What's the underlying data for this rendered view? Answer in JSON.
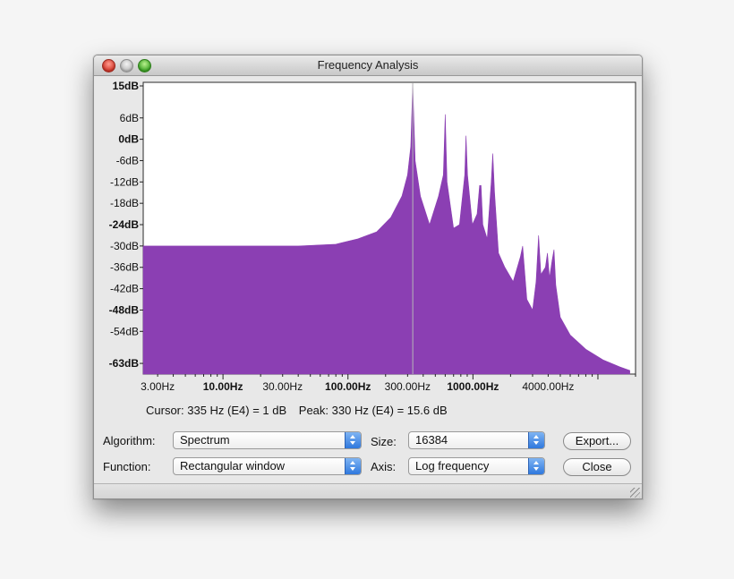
{
  "window": {
    "title": "Frequency Analysis"
  },
  "chart_data": {
    "type": "area",
    "title": "",
    "xlabel": "",
    "ylabel": "",
    "x_scale": "log",
    "xlim": [
      2.3,
      20000
    ],
    "ylim": [
      -66,
      16
    ],
    "grid": false,
    "fill_color": "#8b3fb3",
    "y_ticks": [
      {
        "v": 15,
        "label": "15dB",
        "major": true
      },
      {
        "v": 6,
        "label": "6dB",
        "major": false
      },
      {
        "v": 0,
        "label": "0dB",
        "major": true
      },
      {
        "v": -6,
        "label": "-6dB",
        "major": false
      },
      {
        "v": -12,
        "label": "-12dB",
        "major": false
      },
      {
        "v": -18,
        "label": "-18dB",
        "major": false
      },
      {
        "v": -24,
        "label": "-24dB",
        "major": true
      },
      {
        "v": -30,
        "label": "-30dB",
        "major": false
      },
      {
        "v": -36,
        "label": "-36dB",
        "major": false
      },
      {
        "v": -42,
        "label": "-42dB",
        "major": false
      },
      {
        "v": -48,
        "label": "-48dB",
        "major": true
      },
      {
        "v": -54,
        "label": "-54dB",
        "major": false
      },
      {
        "v": -63,
        "label": "-63dB",
        "major": true
      }
    ],
    "x_ticks": [
      {
        "v": 3,
        "label": "3.00Hz",
        "major": false
      },
      {
        "v": 10,
        "label": "10.00Hz",
        "major": true
      },
      {
        "v": 30,
        "label": "30.00Hz",
        "major": false
      },
      {
        "v": 100,
        "label": "100.00Hz",
        "major": true
      },
      {
        "v": 300,
        "label": "300.00Hz",
        "major": false
      },
      {
        "v": 1000,
        "label": "1000.00Hz",
        "major": true
      },
      {
        "v": 4000,
        "label": "4000.00Hz",
        "major": false
      }
    ],
    "spectrum": [
      {
        "x": 2.3,
        "y": -30
      },
      {
        "x": 10,
        "y": -30
      },
      {
        "x": 40,
        "y": -30
      },
      {
        "x": 80,
        "y": -29.5
      },
      {
        "x": 120,
        "y": -28
      },
      {
        "x": 170,
        "y": -26
      },
      {
        "x": 220,
        "y": -22
      },
      {
        "x": 270,
        "y": -16
      },
      {
        "x": 300,
        "y": -10
      },
      {
        "x": 318,
        "y": -2
      },
      {
        "x": 330,
        "y": 15.6
      },
      {
        "x": 345,
        "y": -6
      },
      {
        "x": 380,
        "y": -16
      },
      {
        "x": 450,
        "y": -24
      },
      {
        "x": 530,
        "y": -16
      },
      {
        "x": 580,
        "y": -10
      },
      {
        "x": 600,
        "y": 7
      },
      {
        "x": 620,
        "y": -12
      },
      {
        "x": 700,
        "y": -25
      },
      {
        "x": 780,
        "y": -24
      },
      {
        "x": 860,
        "y": -10
      },
      {
        "x": 880,
        "y": 1
      },
      {
        "x": 905,
        "y": -10
      },
      {
        "x": 990,
        "y": -24
      },
      {
        "x": 1080,
        "y": -21
      },
      {
        "x": 1130,
        "y": -13
      },
      {
        "x": 1160,
        "y": -13
      },
      {
        "x": 1200,
        "y": -24
      },
      {
        "x": 1300,
        "y": -28
      },
      {
        "x": 1400,
        "y": -12
      },
      {
        "x": 1440,
        "y": -4
      },
      {
        "x": 1490,
        "y": -15
      },
      {
        "x": 1600,
        "y": -32
      },
      {
        "x": 1800,
        "y": -36
      },
      {
        "x": 2100,
        "y": -40
      },
      {
        "x": 2400,
        "y": -33
      },
      {
        "x": 2500,
        "y": -30
      },
      {
        "x": 2700,
        "y": -45
      },
      {
        "x": 3000,
        "y": -48
      },
      {
        "x": 3200,
        "y": -40
      },
      {
        "x": 3350,
        "y": -27
      },
      {
        "x": 3500,
        "y": -38
      },
      {
        "x": 3800,
        "y": -36
      },
      {
        "x": 3950,
        "y": -32
      },
      {
        "x": 4100,
        "y": -39
      },
      {
        "x": 4300,
        "y": -34
      },
      {
        "x": 4450,
        "y": -31
      },
      {
        "x": 4600,
        "y": -41
      },
      {
        "x": 5000,
        "y": -50
      },
      {
        "x": 6000,
        "y": -55
      },
      {
        "x": 8000,
        "y": -59
      },
      {
        "x": 11000,
        "y": -62
      },
      {
        "x": 15000,
        "y": -64
      },
      {
        "x": 18000,
        "y": -65
      }
    ],
    "cursor_x": 330,
    "cursor_color": "#b7b7b7"
  },
  "readout": {
    "cursor": "Cursor: 335 Hz (E4) = 1 dB",
    "peak": "Peak: 330 Hz (E4) = 15.6 dB"
  },
  "controls": {
    "algorithm_label": "Algorithm:",
    "algorithm_value": "Spectrum",
    "function_label": "Function:",
    "function_value": "Rectangular window",
    "size_label": "Size:",
    "size_value": "16384",
    "axis_label": "Axis:",
    "axis_value": "Log frequency",
    "export_label": "Export...",
    "close_label": "Close"
  }
}
